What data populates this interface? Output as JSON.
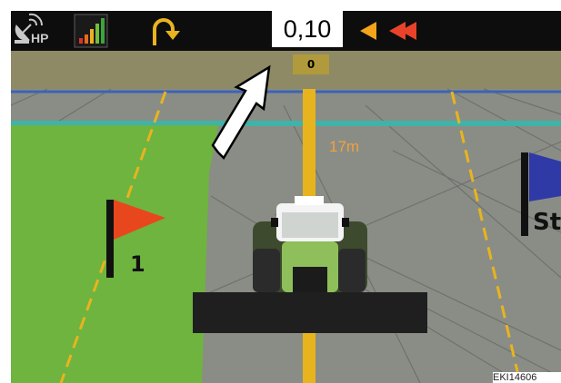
{
  "status_bar": {
    "gps_status_label": "HP",
    "gps_icon": "satellite-dish-icon",
    "signal_icon": "signal-strength-icon",
    "turn_icon": "u-turn-arrow-icon",
    "offset_value": "0,10",
    "steer_indicator_icons": [
      "arrow-left-single-icon",
      "arrow-left-double-icon"
    ],
    "colors": {
      "bar": "#0d0d0d",
      "offset_box": "#ffffff",
      "steer_single": "#f5a31a",
      "steer_double": "#e8432a"
    }
  },
  "guidance": {
    "swath_number": "0",
    "distance_label": "17m"
  },
  "markers": {
    "left_flag_label": "1",
    "right_flag_label": "St"
  },
  "figure": {
    "reference_code": "EKI14606"
  },
  "colors": {
    "field_green": "#6eb43f",
    "ground_gray": "#8a8d86",
    "guide_line": "#e8b41e",
    "boundary_blue": "#3b64b4",
    "boundary_teal": "#3fb3a7",
    "left_flag": "#e8471e",
    "right_flag": "#2f3aa6"
  }
}
